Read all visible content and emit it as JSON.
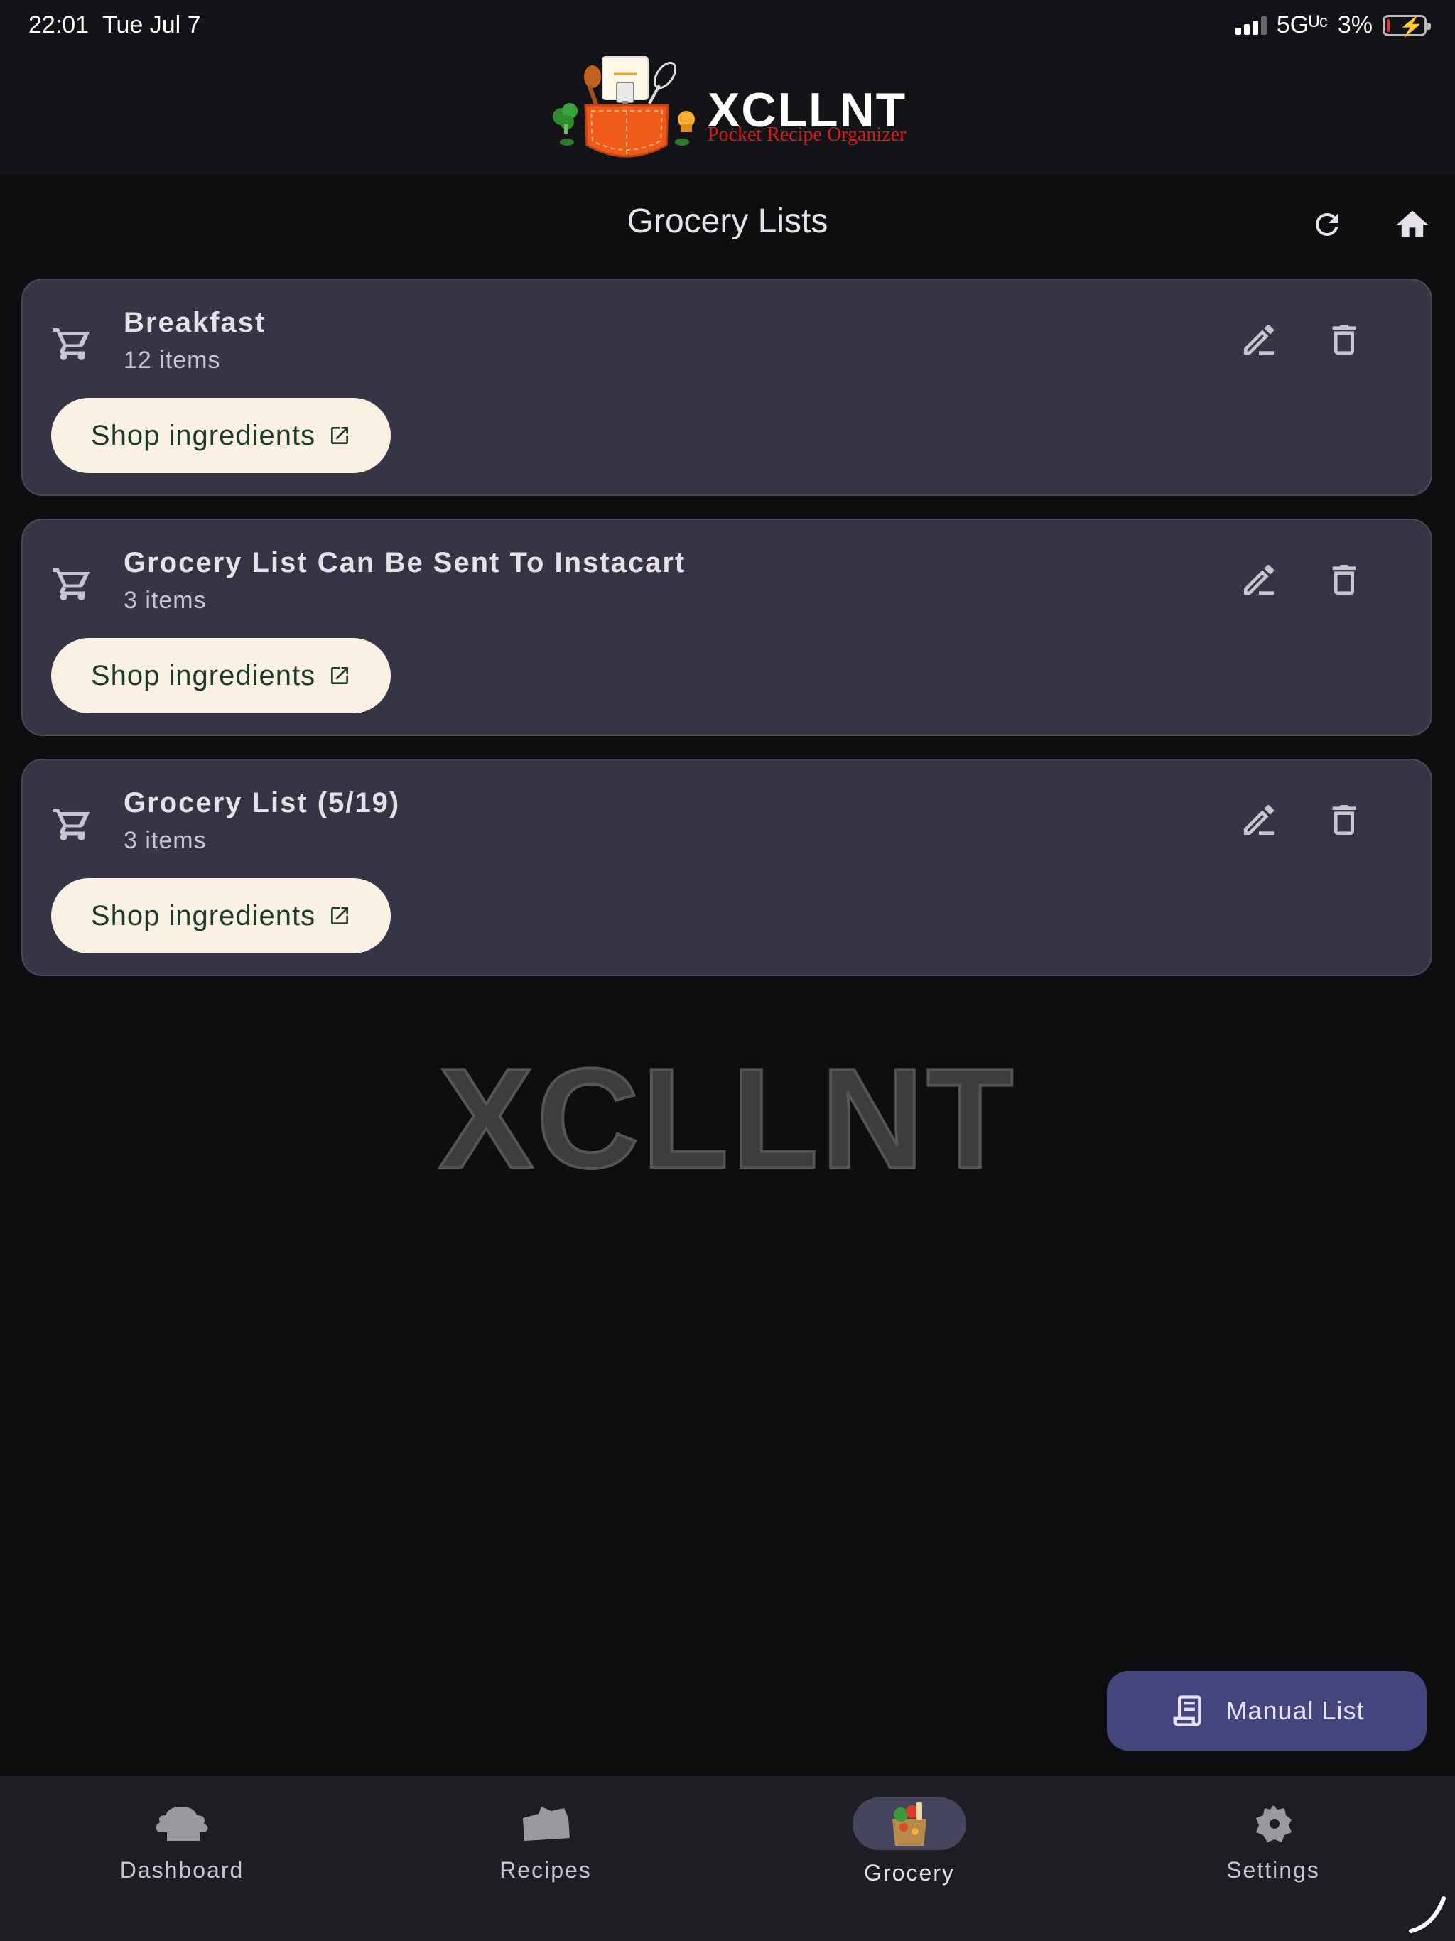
{
  "status_bar": {
    "time": "22:01",
    "date": "Tue Jul 7",
    "network": "5Gᵁᶜ",
    "battery": "3%"
  },
  "brand": {
    "title": "XCLLNT",
    "subtitle": "Pocket Recipe Organizer"
  },
  "header": {
    "title": "Grocery Lists",
    "refresh_icon": "refresh-icon",
    "home_icon": "home-icon"
  },
  "lists": [
    {
      "name": "Breakfast",
      "count": "12 items",
      "button": "Shop ingredients"
    },
    {
      "name": "Grocery List Can Be Sent To Instacart",
      "count": "3 items",
      "button": "Shop ingredients"
    },
    {
      "name": "Grocery List (5/19)",
      "count": "3 items",
      "button": "Shop ingredients"
    }
  ],
  "watermark": "XCLLNT",
  "fab": {
    "label": "Manual List"
  },
  "nav": {
    "items": [
      {
        "label": "Dashboard",
        "icon": "dashboard-icon"
      },
      {
        "label": "Recipes",
        "icon": "recipes-icon"
      },
      {
        "label": "Grocery",
        "icon": "grocery-icon",
        "active": true
      },
      {
        "label": "Settings",
        "icon": "settings-icon"
      }
    ]
  },
  "colors": {
    "background": "#0e0e11",
    "card": "#363545",
    "button": "#faf1e4",
    "button_text": "#1d3b2a",
    "fab": "#45457e",
    "logo_subtitle": "#d91a1a"
  }
}
